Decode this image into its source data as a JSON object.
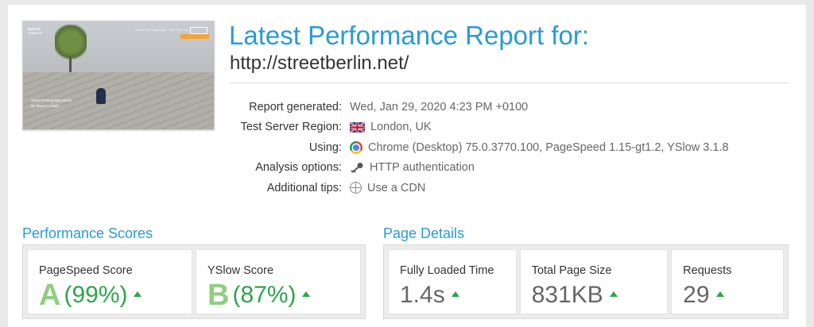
{
  "thumbnail": {
    "logo_line1": "MARTIN",
    "logo_line2": "U WALTZ",
    "nav": "Home   Photographie   Info   Tour   Kon",
    "caption_line1": "Street Photography Berlin",
    "caption_line2": "By Martin U Waltz"
  },
  "header": {
    "title": "Latest Performance Report for:",
    "url": "http://streetberlin.net/"
  },
  "info": [
    {
      "label": "Report generated:",
      "value": "Wed, Jan 29, 2020 4:23 PM +0100",
      "icon": ""
    },
    {
      "label": "Test Server Region:",
      "value": "London, UK",
      "icon": "uk-flag-icon"
    },
    {
      "label": "Using:",
      "value": "Chrome (Desktop) 75.0.3770.100, PageSpeed 1.15-gt1.2, YSlow 3.1.8",
      "icon": "chrome-icon"
    },
    {
      "label": "Analysis options:",
      "value": "HTTP authentication",
      "icon": "key-icon"
    },
    {
      "label": "Additional tips:",
      "value": "Use a CDN",
      "icon": "globe-icon"
    }
  ],
  "performance": {
    "title": "Performance Scores",
    "pagespeed": {
      "label": "PageSpeed Score",
      "grade": "A",
      "percent": "(99%)"
    },
    "yslow": {
      "label": "YSlow Score",
      "grade": "B",
      "percent": "(87%)"
    }
  },
  "details": {
    "title": "Page Details",
    "loaded": {
      "label": "Fully Loaded Time",
      "value": "1.4s"
    },
    "size": {
      "label": "Total Page Size",
      "value": "831KB"
    },
    "requests": {
      "label": "Requests",
      "value": "29"
    }
  },
  "colors": {
    "accent": "#2a9ad6",
    "grade_green": "#8fcf7f",
    "trend_green": "#2ba64a"
  }
}
